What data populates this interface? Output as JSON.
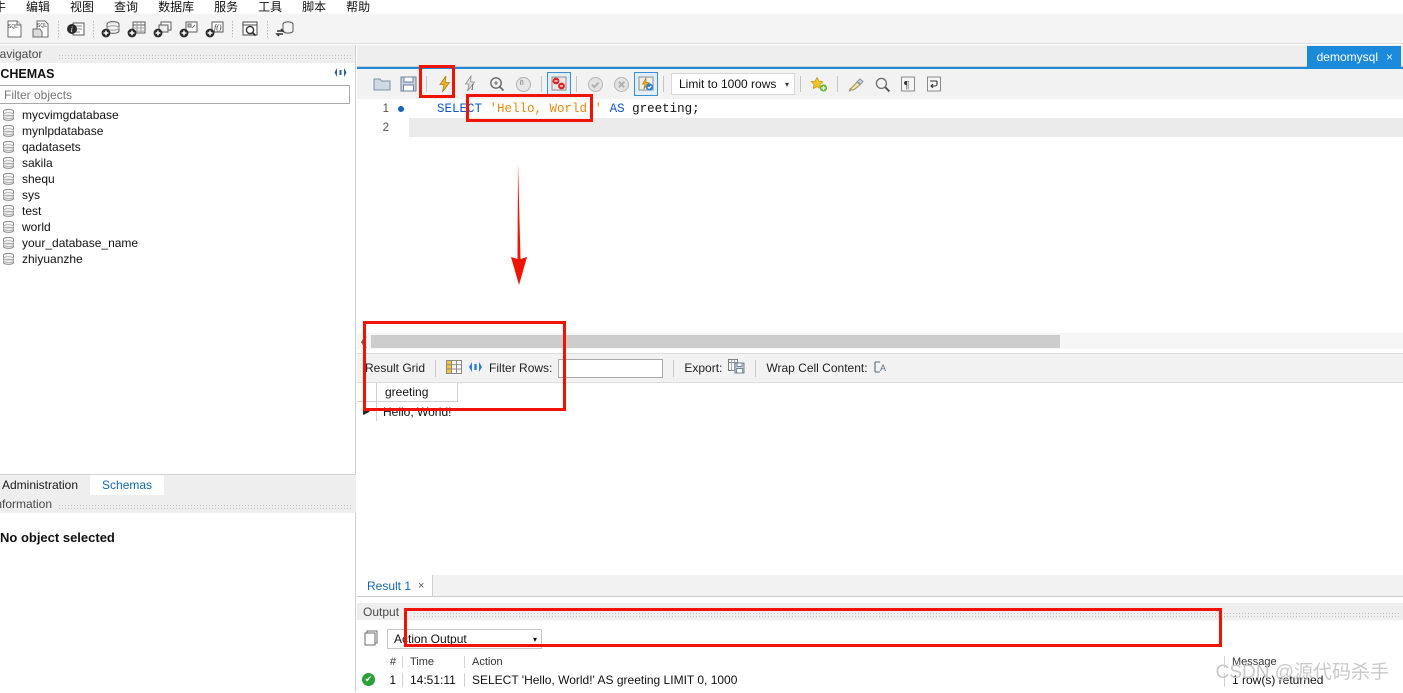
{
  "menu": {
    "items": [
      {
        "label": "牛"
      },
      {
        "label": "编辑"
      },
      {
        "label": "视图"
      },
      {
        "label": "查询"
      },
      {
        "label": "数据库"
      },
      {
        "label": "服务"
      },
      {
        "label": "工具"
      },
      {
        "label": "脚本"
      },
      {
        "label": "帮助"
      }
    ]
  },
  "toolbar": {
    "buttons": [
      {
        "name": "new-sql-file-icon",
        "title": "New SQL Tab"
      },
      {
        "name": "open-sql-file-icon",
        "title": "Open SQL Script"
      },
      {
        "name": "connection-info-icon",
        "title": "Connection Info"
      },
      {
        "name": "create-schema-icon",
        "title": "Create Schema"
      },
      {
        "name": "create-table-icon",
        "title": "Create Table"
      },
      {
        "name": "create-view-icon",
        "title": "Create View"
      },
      {
        "name": "create-procedure-icon",
        "title": "Create Stored Procedure"
      },
      {
        "name": "create-function-icon",
        "title": "Create Function"
      },
      {
        "name": "inspect-schema-icon",
        "title": "Schema Inspector"
      },
      {
        "name": "sync-model-icon",
        "title": "Reconnect / Sync"
      }
    ]
  },
  "navigator": {
    "caption": "Navigator",
    "section_title": "SCHEMAS",
    "refresh_label": "refresh-icon",
    "filter_placeholder": "Filter objects",
    "schemas": [
      "mycvimgdatabase",
      "mynlpdatabase",
      "qadatasets",
      "sakila",
      "shequ",
      "sys",
      "test",
      "world",
      "your_database_name",
      "zhiyuanzhe"
    ],
    "tabs": [
      {
        "label": "Administration",
        "active": false
      },
      {
        "label": "Schemas",
        "active": true
      }
    ],
    "information_caption": "Information",
    "no_object_text": "No object selected"
  },
  "document_tab": {
    "label": "demomysql",
    "close_label": "×"
  },
  "sql_toolbar": {
    "buttons": [
      {
        "name": "open-script-icon"
      },
      {
        "name": "save-script-icon"
      },
      {
        "name": "execute-statement-icon"
      },
      {
        "name": "execute-current-statement-icon"
      },
      {
        "name": "explain-statement-icon"
      },
      {
        "name": "stop-execution-icon"
      },
      {
        "name": "toggle-stop-on-error-icon"
      },
      {
        "name": "commit-icon"
      },
      {
        "name": "rollback-icon"
      },
      {
        "name": "toggle-autocommit-icon"
      }
    ],
    "limit_label": "Limit to 1000 rows",
    "limit_caret": "▾",
    "right_buttons": [
      {
        "name": "save-snippet-icon"
      },
      {
        "name": "beautify-query-icon"
      },
      {
        "name": "find-icon"
      },
      {
        "name": "toggle-invisible-chars-icon"
      },
      {
        "name": "toggle-word-wrap-icon"
      }
    ]
  },
  "editor": {
    "lines": [
      {
        "number": "1",
        "has_marker": true,
        "tokens": [
          {
            "text": "SELECT ",
            "kind": "kw"
          },
          {
            "text": "'Hello, World!'",
            "kind": "str"
          },
          {
            "text": " ",
            "kind": "plain"
          },
          {
            "text": "AS",
            "kind": "kw"
          },
          {
            "text": " greeting;",
            "kind": "plain"
          }
        ]
      },
      {
        "number": "2",
        "has_marker": false,
        "tokens": []
      }
    ]
  },
  "result_grid_toolbar": {
    "label": "Result Grid",
    "grid-view-icon": "grid-view-icon",
    "refresh-icon": "refresh-grid-icon",
    "filter_label": "Filter Rows:",
    "filter_value": "",
    "export_label": "Export:",
    "export-icon": "export-icon",
    "wrap_label": "Wrap Cell Content:",
    "wrap-icon": "wrap-cell-icon"
  },
  "result_grid": {
    "columns": [
      "greeting"
    ],
    "rows": [
      {
        "marker": "▶",
        "cells": [
          "Hello, World!"
        ]
      }
    ]
  },
  "result_tabs": [
    {
      "label": "Result 1",
      "close": "×",
      "active": true
    }
  ],
  "output": {
    "caption": "Output",
    "selector_label": "Action Output",
    "selector_caret": "▾",
    "columns": [
      "#",
      "Time",
      "Action",
      "Message"
    ],
    "rows": [
      {
        "status": "success",
        "status_glyph": "✔",
        "num": "1",
        "time": "14:51:11",
        "action": "SELECT 'Hello, World!' AS greeting LIMIT 0, 1000",
        "message": "1 row(s) returned"
      }
    ]
  },
  "annotations": {
    "highlight_color": "#f01400",
    "arrow": "down-arrow"
  },
  "watermark": {
    "text": "CSDN @源代码杀手"
  }
}
